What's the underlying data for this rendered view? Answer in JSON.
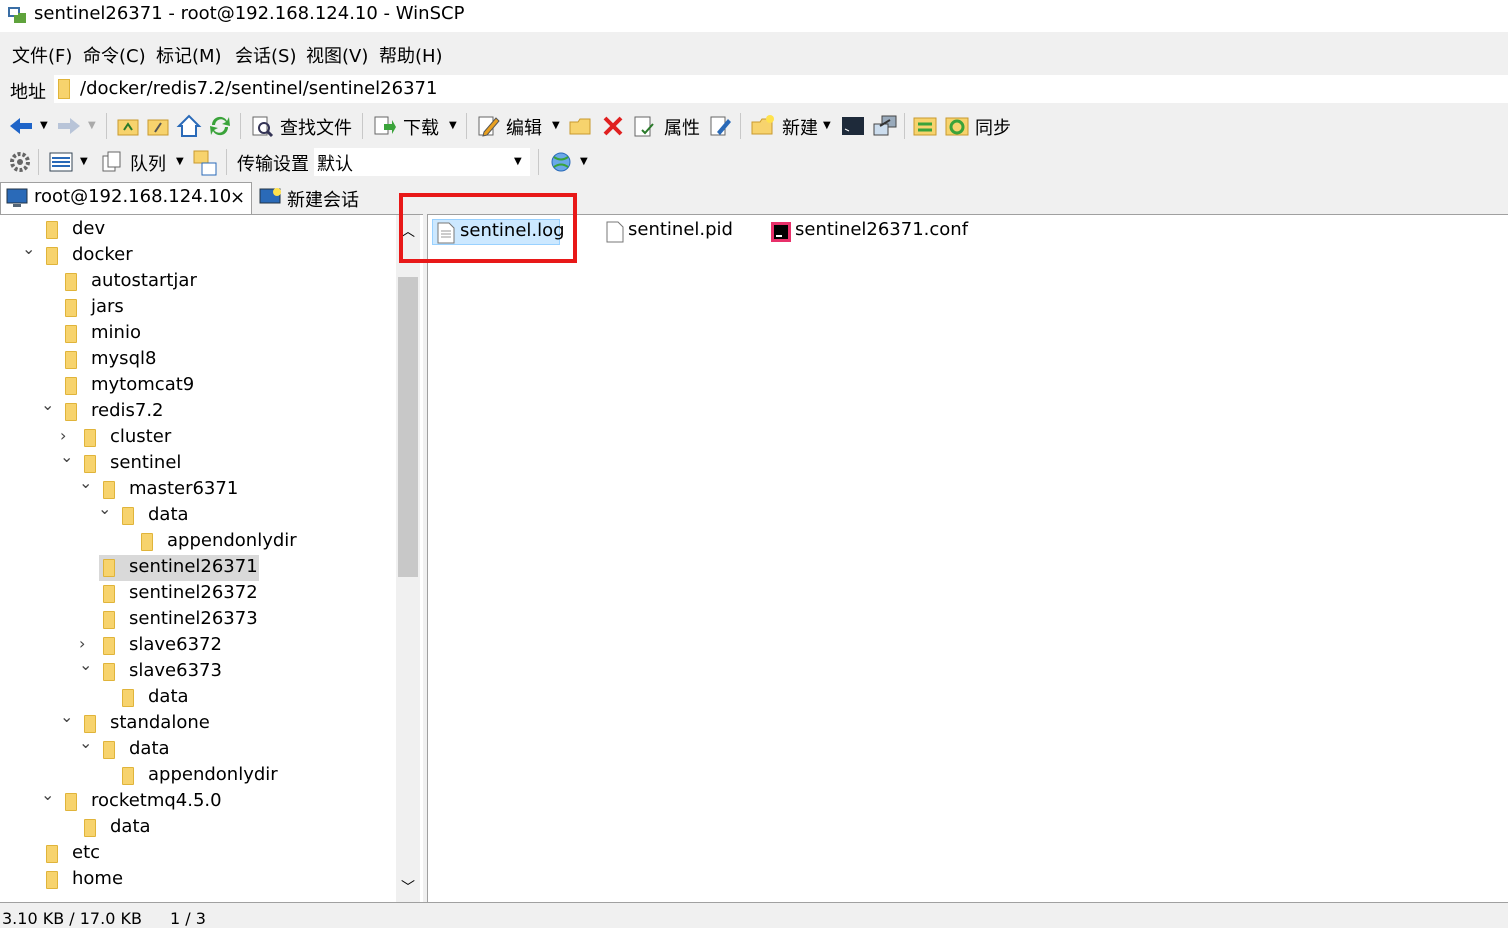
{
  "window": {
    "title": "sentinel26371 - root@192.168.124.10 - WinSCP"
  },
  "menu": [
    "文件(F)",
    "命令(C)",
    "标记(M)",
    "会话(S)",
    "视图(V)",
    "帮助(H)"
  ],
  "address": {
    "label": "地址",
    "path": "/docker/redis7.2/sentinel/sentinel26371"
  },
  "toolbar1": {
    "find_label": "查找文件",
    "download_label": "下载",
    "edit_label": "编辑",
    "properties_label": "属性",
    "new_label": "新建",
    "sync_label": "同步"
  },
  "toolbar2": {
    "queue_label": "队列",
    "transfer_label": "传输设置",
    "transfer_value": "默认"
  },
  "tabs": {
    "session": "root@192.168.124.10",
    "session_close": "×",
    "new_session": "新建会话"
  },
  "tree": [
    {
      "label": "dev",
      "state": "none"
    },
    {
      "label": "docker",
      "state": "expanded"
    },
    {
      "label": "autostartjar",
      "state": "none"
    },
    {
      "label": "jars",
      "state": "none"
    },
    {
      "label": "minio",
      "state": "none"
    },
    {
      "label": "mysql8",
      "state": "none"
    },
    {
      "label": "mytomcat9",
      "state": "none"
    },
    {
      "label": "redis7.2",
      "state": "expanded"
    },
    {
      "label": "cluster",
      "state": "collapsed"
    },
    {
      "label": "sentinel",
      "state": "expanded"
    },
    {
      "label": "master6371",
      "state": "expanded"
    },
    {
      "label": "data",
      "state": "expanded"
    },
    {
      "label": "appendonlydir",
      "state": "none"
    },
    {
      "label": "sentinel26371",
      "state": "none",
      "selected": true
    },
    {
      "label": "sentinel26372",
      "state": "none"
    },
    {
      "label": "sentinel26373",
      "state": "none"
    },
    {
      "label": "slave6372",
      "state": "collapsed"
    },
    {
      "label": "slave6373",
      "state": "expanded"
    },
    {
      "label": "data",
      "state": "none"
    },
    {
      "label": "standalone",
      "state": "expanded"
    },
    {
      "label": "data",
      "state": "expanded"
    },
    {
      "label": "appendonlydir",
      "state": "none"
    },
    {
      "label": "rocketmq4.5.0",
      "state": "expanded"
    },
    {
      "label": "data",
      "state": "none"
    },
    {
      "label": "etc",
      "state": "none"
    },
    {
      "label": "home",
      "state": "none"
    }
  ],
  "files": [
    {
      "name": "sentinel.log",
      "icon": "text-file-icon",
      "selected": true
    },
    {
      "name": "sentinel.pid",
      "icon": "blank-file-icon"
    },
    {
      "name": "sentinel26371.conf",
      "icon": "jetbrains-file-icon"
    }
  ],
  "status": {
    "size": "3.10 KB / 17.0 KB",
    "count": "1 / 3"
  },
  "colors": {
    "highlight": "#e81818",
    "folder": "#f7d36d",
    "selection": "#cce8ff"
  }
}
